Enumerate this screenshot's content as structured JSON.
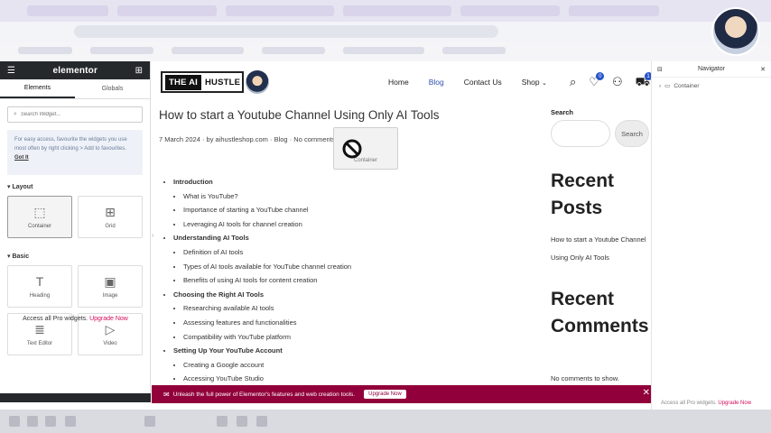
{
  "elementor": {
    "brand": "elementor",
    "tabs": [
      "Elements",
      "Globals"
    ],
    "search_placeholder": "Search Widget...",
    "hint_text": "For easy access, favourite the widgets you use most often by right clicking > Add to favourites.",
    "hint_link": "Got It",
    "layout_title": "Layout",
    "layout_widgets": [
      "Container",
      "Grid"
    ],
    "basic_title": "Basic",
    "basic_widgets": [
      "Heading",
      "Image",
      "Text Editor",
      "Video"
    ],
    "promo_text": "Access all Pro widgets.",
    "promo_link": "Upgrade Now"
  },
  "site": {
    "logo_the": "THE AI",
    "logo_hustle": "HUSTLE",
    "nav": [
      "Home",
      "Blog",
      "Contact Us",
      "Shop"
    ],
    "wishlist_count": "0",
    "cart_count": "1"
  },
  "post": {
    "title": "How to start a Youtube Channel Using Only AI Tools",
    "date": "7 March 2024",
    "author": "by aihustleshop.com",
    "category": "Blog",
    "comments": "No comments yet",
    "drag_label": "Container",
    "toc": [
      {
        "title": "Introduction",
        "items": [
          "What is YouTube?",
          "Importance of starting a YouTube channel",
          "Leveraging AI tools for channel creation"
        ]
      },
      {
        "title": "Understanding AI Tools",
        "items": [
          "Definition of AI tools",
          "Types of AI tools available for YouTube channel creation",
          "Benefits of using AI tools for content creation"
        ]
      },
      {
        "title": "Choosing the Right AI Tools",
        "items": [
          "Researching available AI tools",
          "Assessing features and functionalities",
          "Compatibility with YouTube platform"
        ]
      },
      {
        "title": "Setting Up Your YouTube Account",
        "items": [
          "Creating a Google account",
          "Accessing YouTube Studio"
        ]
      }
    ]
  },
  "sidebar": {
    "search_label": "Search",
    "search_button": "Search",
    "recent_posts_title": "Recent Posts",
    "recent_post": "How to start a Youtube Channel Using Only AI Tools",
    "recent_comments_title": "Recent Comments",
    "no_comments": "No comments to show."
  },
  "promo_bar": {
    "text": "Unleash the full power of Elementor's features and web creation tools.",
    "button": "Upgrade Now"
  },
  "navigator": {
    "title": "Navigator",
    "item": "Container",
    "footer_text": "Access all Pro widgets.",
    "footer_link": "Upgrade Now"
  },
  "colors": {
    "elementor_dark": "#26292c",
    "promo": "#92003b",
    "accent_blue": "#2f4fae"
  }
}
